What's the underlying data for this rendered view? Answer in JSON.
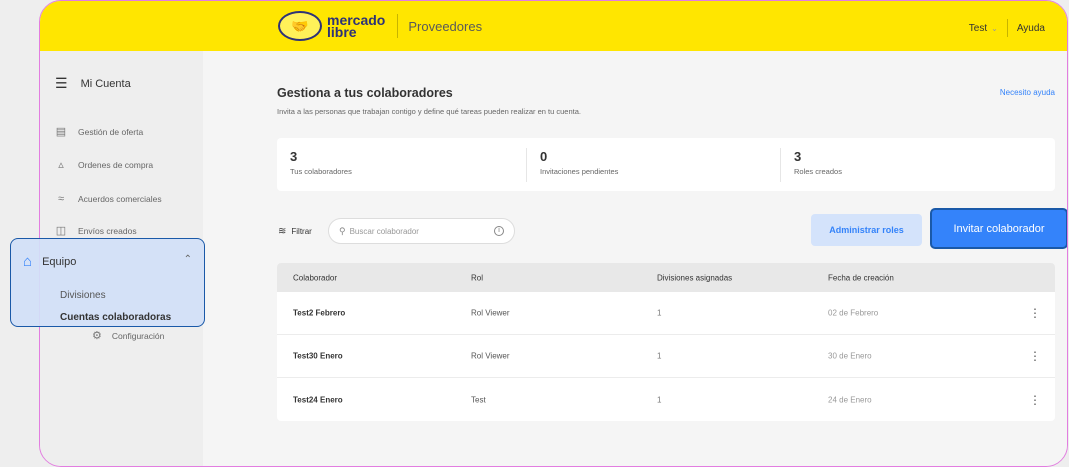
{
  "header": {
    "logo_line1": "mercado",
    "logo_line2": "libre",
    "section": "Proveedores",
    "user": "Test",
    "help": "Ayuda"
  },
  "sidebar": {
    "title": "Mi Cuenta",
    "items": [
      {
        "label": "Gestión de oferta",
        "icon": "document-icon"
      },
      {
        "label": "Ordenes de compra",
        "icon": "shopping-bag-icon"
      },
      {
        "label": "Acuerdos comerciales",
        "icon": "handshake-icon"
      },
      {
        "label": "Envíos creados",
        "icon": "truck-icon"
      }
    ],
    "expanded_group": {
      "label": "Equipo",
      "icon": "store-icon",
      "sub_items": [
        "Divisiones",
        "Cuentas colaboradoras"
      ],
      "active": "Cuentas colaboradoras"
    },
    "config": {
      "label": "Configuración",
      "icon": "gear-icon"
    }
  },
  "main": {
    "title": "Gestiona a tus colaboradores",
    "subtitle": "Invita a las personas que trabajan contigo y define qué tareas pueden realizar en tu cuenta.",
    "help_link": "Necesito ayuda",
    "stats": [
      {
        "value": "3",
        "label": "Tus colaboradores"
      },
      {
        "value": "0",
        "label": "Invitaciones pendientes"
      },
      {
        "value": "3",
        "label": "Roles creados"
      }
    ],
    "filter_label": "Filtrar",
    "search_placeholder": "Buscar colaborador",
    "btn_roles": "Administrar roles",
    "btn_invite": "Invitar colaborador",
    "table": {
      "headers": [
        "Colaborador",
        "Rol",
        "Divisiones asignadas",
        "Fecha de creación"
      ],
      "rows": [
        {
          "name": "Test2 Febrero",
          "role": "Rol Viewer",
          "divisions": "1",
          "date": "02 de Febrero"
        },
        {
          "name": "Test30 Enero",
          "role": "Rol Viewer",
          "divisions": "1",
          "date": "30 de Enero"
        },
        {
          "name": "Test24 Enero",
          "role": "Test",
          "divisions": "1",
          "date": "24 de Enero"
        }
      ]
    }
  },
  "colors": {
    "brand_yellow": "#ffe600",
    "accent_blue": "#3483fa",
    "frame_outline": "#e27de0"
  }
}
